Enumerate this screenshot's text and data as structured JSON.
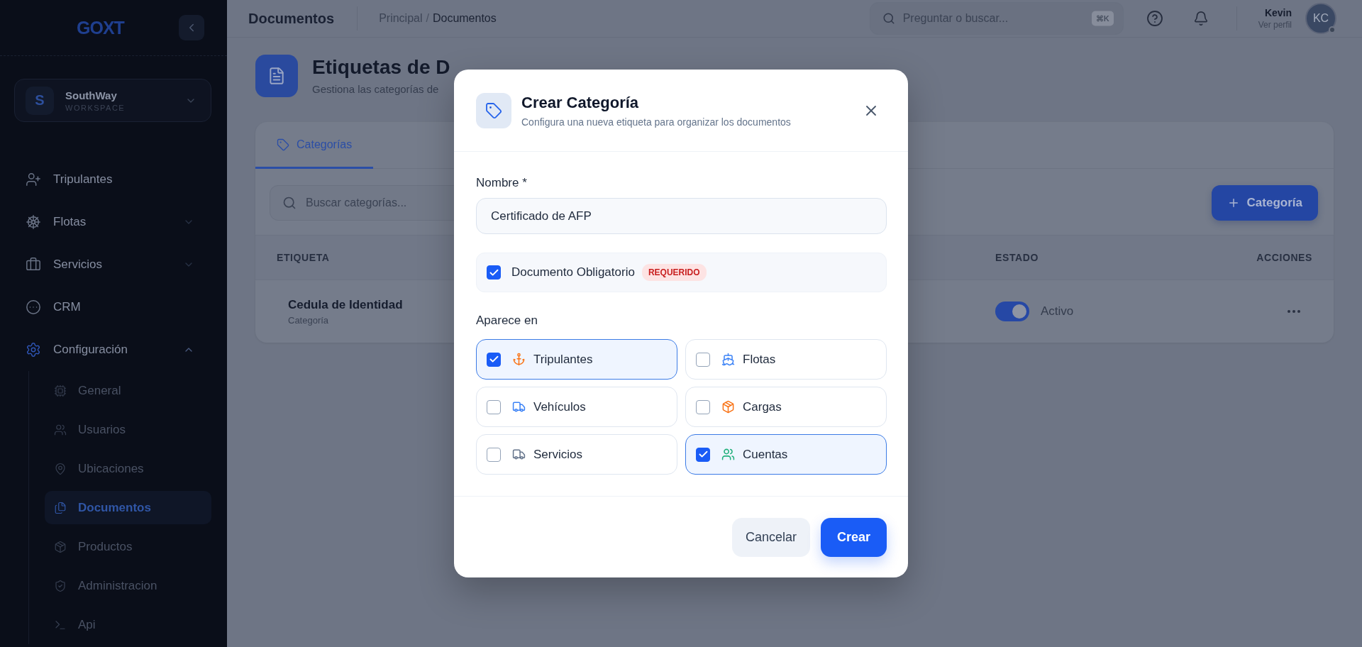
{
  "sidebar": {
    "logo": "GOXT",
    "workspace": {
      "initial": "S",
      "name": "SouthWay",
      "label": "WORKSPACE"
    },
    "items": [
      {
        "label": "Tripulantes",
        "kind": "link",
        "selected": false
      },
      {
        "label": "Flotas",
        "kind": "group",
        "selected": false,
        "expanded": false
      },
      {
        "label": "Servicios",
        "kind": "group",
        "selected": false,
        "expanded": false
      },
      {
        "label": "CRM",
        "kind": "link",
        "selected": false
      },
      {
        "label": "Configuración",
        "kind": "group",
        "selected": true,
        "expanded": true,
        "children": [
          {
            "label": "General",
            "selected": false
          },
          {
            "label": "Usuarios",
            "selected": false
          },
          {
            "label": "Ubicaciones",
            "selected": false
          },
          {
            "label": "Documentos",
            "selected": true
          },
          {
            "label": "Productos",
            "selected": false
          },
          {
            "label": "Administracion",
            "selected": false
          },
          {
            "label": "Api",
            "selected": false
          }
        ]
      }
    ]
  },
  "topbar": {
    "title": "Documentos",
    "breadcrumb": [
      "Principal",
      "Documentos"
    ],
    "separator": "/",
    "search": {
      "placeholder": "Preguntar o buscar...",
      "shortcut": "⌘K"
    },
    "user": {
      "name": "Kevin",
      "link": "Ver perfil",
      "initials": "KC",
      "online": true
    }
  },
  "page": {
    "title": "Etiquetas de D",
    "subtitle": "Gestiona las categorías de",
    "tabs": [
      {
        "label": "Categorías",
        "selected": true
      }
    ],
    "search": {
      "placeholder": "Buscar categorías..."
    },
    "add_button": "Categoría",
    "table": {
      "columns": [
        "ETIQUETA",
        "ESTADO",
        "ACCIONES"
      ],
      "rows": [
        {
          "name": "Cedula de Identidad",
          "type": "Categoría",
          "active": true,
          "status": "Activo"
        }
      ]
    }
  },
  "modal": {
    "title": "Crear Categoría",
    "subtitle": "Configura una nueva etiqueta para organizar los documentos",
    "name_field": {
      "label": "Nombre *",
      "value": "Certificado de AFP"
    },
    "required": {
      "label": "Documento Obligatorio",
      "checked": true,
      "badge": "REQUERIDO"
    },
    "appears_in": {
      "label": "Aparece en",
      "options": [
        {
          "label": "Tripulantes",
          "checked": true,
          "color": "#f97316"
        },
        {
          "label": "Flotas",
          "checked": false,
          "color": "#3b82f6"
        },
        {
          "label": "Vehículos",
          "checked": false,
          "color": "#3b82f6"
        },
        {
          "label": "Cargas",
          "checked": false,
          "color": "#f97316"
        },
        {
          "label": "Servicios",
          "checked": false,
          "color": "#64748b"
        },
        {
          "label": "Cuentas",
          "checked": true,
          "color": "#22b07d"
        }
      ]
    },
    "buttons": [
      {
        "label": "Cancelar",
        "kind": "secondary"
      },
      {
        "label": "Crear",
        "kind": "primary"
      }
    ]
  }
}
